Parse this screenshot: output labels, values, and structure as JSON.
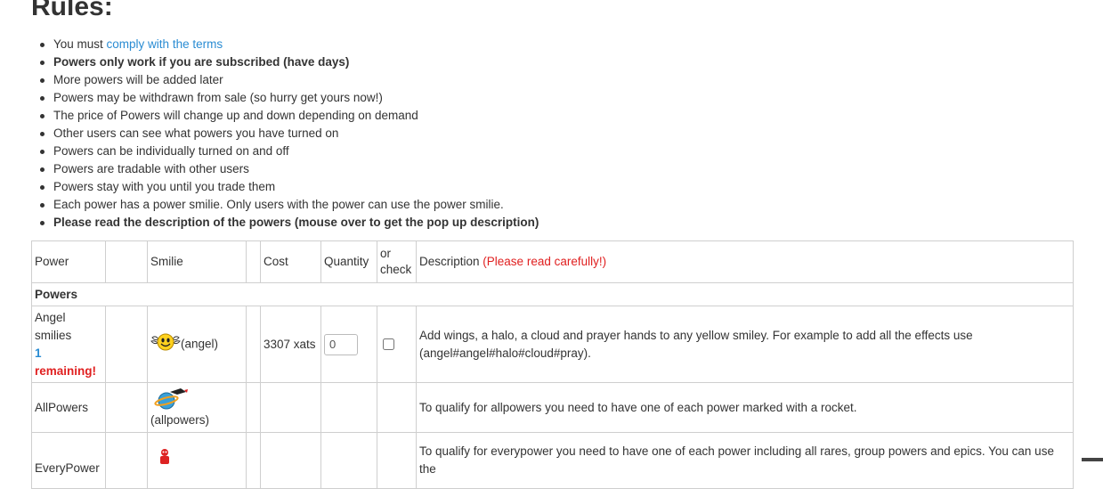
{
  "heading": "Rules:",
  "rules": {
    "r0_prefix": "You must ",
    "r0_link": "comply with the terms",
    "r1": "Powers only work if you are subscribed (have days)",
    "r2": "More powers will be added later",
    "r3": "Powers may be withdrawn from sale (so hurry get yours now!)",
    "r4": "The price of Powers will change up and down depending on demand",
    "r5": "Other users can see what powers you have turned on",
    "r6": "Powers can be individually turned on and off",
    "r7": "Powers are tradable with other users",
    "r8": "Powers stay with you until you trade them",
    "r9": "Each power has a power smilie. Only users with the power can use the power smilie.",
    "r10": "Please read the description of the powers (mouse over to get the pop up description)"
  },
  "table": {
    "headers": {
      "power": "Power",
      "smilie": "Smilie",
      "cost": "Cost",
      "quantity": "Quantity",
      "or": "or",
      "check": "check",
      "description": "Description",
      "description_note": "(Please read carefully!)"
    },
    "group_label": "Powers",
    "rows": {
      "angel": {
        "name_line1": "Angel",
        "name_line2": "smilies",
        "remaining_count": "1",
        "remaining_label": "remaining!",
        "smilie_code": "(angel)",
        "cost": "3307 xats",
        "quantity": "0",
        "description": "Add wings, a halo, a cloud and prayer hands to any yellow smiley. For example to add all the effects use (angel#angel#halo#cloud#pray)."
      },
      "allpowers": {
        "name": "AllPowers",
        "smilie_code": "(allpowers)",
        "description": "To qualify for allpowers you need to have one of each power marked with a rocket."
      },
      "everypower": {
        "name": "EveryPower",
        "description": "To qualify for everypower you need to have one of each power including all rares, group powers and epics. You can use the"
      }
    }
  },
  "colors": {
    "link": "#2a8cd3",
    "warning": "#e02020",
    "border": "#cfcfcf"
  }
}
